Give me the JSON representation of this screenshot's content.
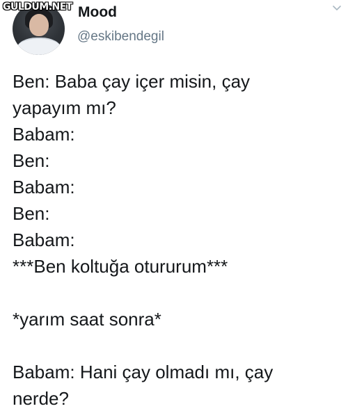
{
  "watermark": "GULDUM.NET",
  "author": {
    "name": "Mood",
    "handle": "@eskibendegil"
  },
  "icons": {
    "menu": "chevron-down-icon",
    "avatar": "profile-photo"
  },
  "tweet": {
    "lines": [
      "Ben: Baba çay içer misin, çay",
      "yapayım mı?",
      "Babam:",
      "Ben:",
      "Babam:",
      "Ben:",
      "Babam:",
      "***Ben koltuğa otururum***",
      "",
      "*yarım saat sonra*",
      "",
      "Babam: Hani çay olmadı mı, çay",
      "nerde?"
    ]
  }
}
